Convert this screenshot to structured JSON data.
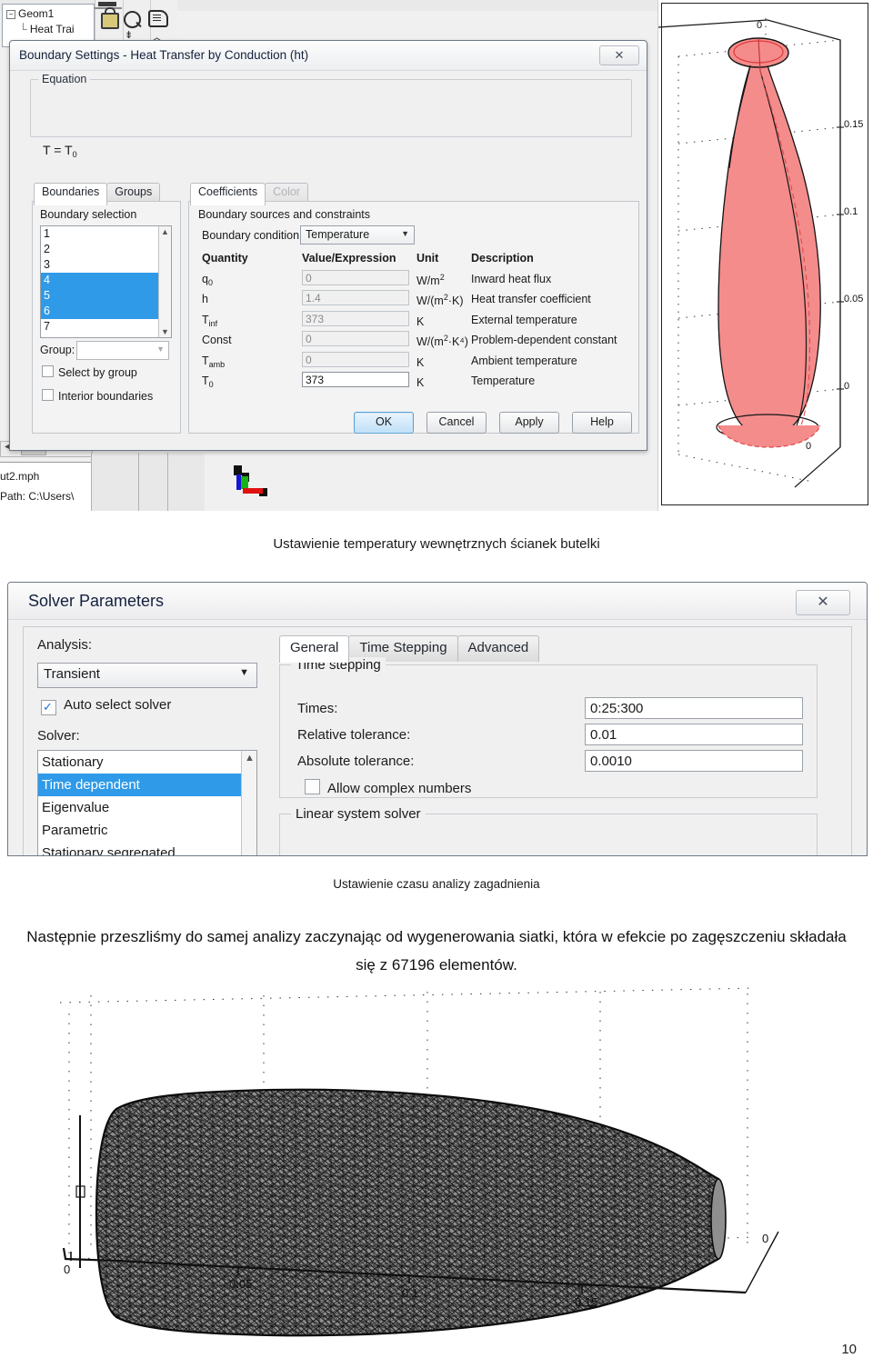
{
  "top_window": {
    "tree": {
      "root": "Geom1",
      "child": "Heat Trai",
      "expander": "−"
    },
    "toolbar_icons": [
      "lock-icon",
      "magnifier-icon",
      "scroll-icon"
    ],
    "file_panel": {
      "filename": "ut2.mph",
      "path": "Path: C:\\Users\\"
    }
  },
  "boundary_dialog": {
    "title": "Boundary Settings - Heat Transfer by Conduction (ht)",
    "close_label": "✕",
    "equation_group": "Equation",
    "equation": {
      "lhs": "T = T",
      "sub": "0"
    },
    "left_tabs": [
      {
        "label": "Boundaries",
        "active": true
      },
      {
        "label": "Groups",
        "active": false
      }
    ],
    "right_tabs": [
      {
        "label": "Coefficients",
        "active": true,
        "disabled": false
      },
      {
        "label": "Color",
        "active": false,
        "disabled": true
      }
    ],
    "boundary_selection": {
      "label": "Boundary selection",
      "items": [
        "1",
        "2",
        "3",
        "4",
        "5",
        "6",
        "7"
      ],
      "selected": [
        "4",
        "5",
        "6"
      ],
      "group_label": "Group:",
      "group_value": "",
      "checkboxes": [
        {
          "label": "Select by group",
          "checked": false
        },
        {
          "label": "Interior boundaries",
          "checked": false
        }
      ]
    },
    "coefficients": {
      "group_label": "Boundary sources and constraints",
      "condition_label": "Boundary condition:",
      "condition_value": "Temperature",
      "headers": [
        "Quantity",
        "Value/Expression",
        "Unit",
        "Description"
      ],
      "rows": [
        {
          "quantity": "q",
          "quantity_sub": "0",
          "value": "0",
          "unit": "W/m",
          "unit_sup": "2",
          "unit_tail": "",
          "description": "Inward heat flux",
          "editable": false
        },
        {
          "quantity": "h",
          "quantity_sub": "",
          "value": "1.4",
          "unit": "W/(m",
          "unit_sup": "2",
          "unit_tail": "·K)",
          "description": "Heat transfer coefficient",
          "editable": false
        },
        {
          "quantity": "T",
          "quantity_sub": "inf",
          "value": "373",
          "unit": "K",
          "unit_sup": "",
          "unit_tail": "",
          "description": "External temperature",
          "editable": false
        },
        {
          "quantity": "Const",
          "quantity_sub": "",
          "value": "0",
          "unit": "W/(m",
          "unit_sup": "2",
          "unit_tail": "·K⁴)",
          "description": "Problem-dependent constant",
          "editable": false
        },
        {
          "quantity": "T",
          "quantity_sub": "amb",
          "value": "0",
          "unit": "K",
          "unit_sup": "",
          "unit_tail": "",
          "description": "Ambient temperature",
          "editable": false
        },
        {
          "quantity": "T",
          "quantity_sub": "0",
          "value": "373",
          "unit": "K",
          "unit_sup": "",
          "unit_tail": "",
          "description": "Temperature",
          "editable": true
        }
      ]
    },
    "buttons": [
      {
        "label": "OK",
        "focused": true
      },
      {
        "label": "Cancel",
        "focused": false
      },
      {
        "label": "Apply",
        "focused": false
      },
      {
        "label": "Help",
        "focused": false
      }
    ]
  },
  "plot_bottle": {
    "axis_ticks_right": [
      "0.15",
      "0.1",
      "0.05",
      "0"
    ],
    "axis_tick_top": "0",
    "axis_tick_bottom": "0",
    "surface_color": "#f48c8c"
  },
  "caption_1": "Ustawienie temperatury wewnętrznych ścianek butelki",
  "solver_dialog": {
    "title": "Solver Parameters",
    "close_label": "✕",
    "analysis_label": "Analysis:",
    "analysis_value": "Transient",
    "auto_select": {
      "label": "Auto select solver",
      "checked": true
    },
    "solver_label": "Solver:",
    "solver_items": [
      "Stationary",
      "Time dependent",
      "Eigenvalue",
      "Parametric",
      "Stationary segregated"
    ],
    "solver_selected": "Time dependent",
    "tabs": [
      {
        "label": "General",
        "active": true
      },
      {
        "label": "Time Stepping",
        "active": false
      },
      {
        "label": "Advanced",
        "active": false
      }
    ],
    "time_stepping_group": "Time stepping",
    "fields": [
      {
        "label": "Times:",
        "value": "0:25:300"
      },
      {
        "label": "Relative tolerance:",
        "value": "0.01"
      },
      {
        "label": "Absolute tolerance:",
        "value": "0.0010"
      }
    ],
    "allow_complex": {
      "label": "Allow complex numbers",
      "checked": false
    },
    "linear_solver_group": "Linear system solver"
  },
  "caption_2": "Ustawienie czasu analizy zagadnienia",
  "paragraph": "Następnie przeszliśmy do samej analizy zaczynając od wygenerowania siatki, która w efekcie po zagęszczeniu składała się z 67196 elementów.",
  "plot_mesh": {
    "axis_ticks_bottom": [
      "0",
      "0.05",
      "0.1",
      "0.15"
    ],
    "axis_tick_right": "0",
    "axis_tick_left": "0",
    "mesh_fill": "#8f8f8f"
  },
  "page_number": "10"
}
